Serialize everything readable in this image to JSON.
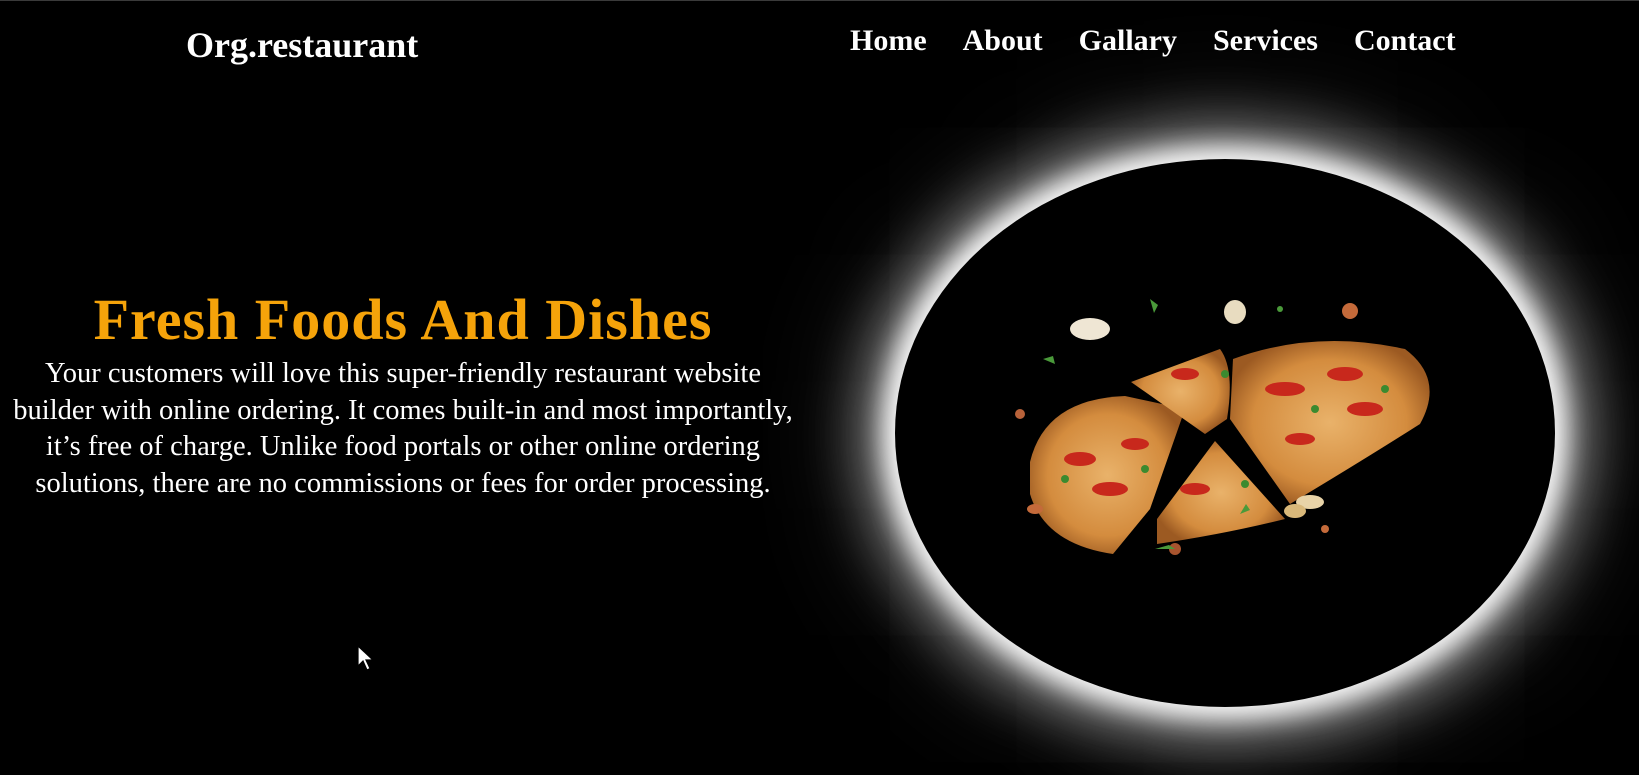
{
  "header": {
    "logo": "Org.restaurant",
    "nav": [
      {
        "label": "Home"
      },
      {
        "label": "About"
      },
      {
        "label": "Gallary"
      },
      {
        "label": "Services"
      },
      {
        "label": "Contact"
      }
    ]
  },
  "hero": {
    "title": "Fresh Foods And Dishes",
    "description": "Your customers will love this super-friendly restaurant website builder with online ordering. It comes built-in and most importantly, it’s free of charge. Unlike food portals or other online ordering solutions, there are no commissions or fees for order processing.",
    "image_icon": "pizza-image"
  },
  "colors": {
    "background": "#000000",
    "accent": "#f5a30a",
    "text": "#ffffff"
  }
}
